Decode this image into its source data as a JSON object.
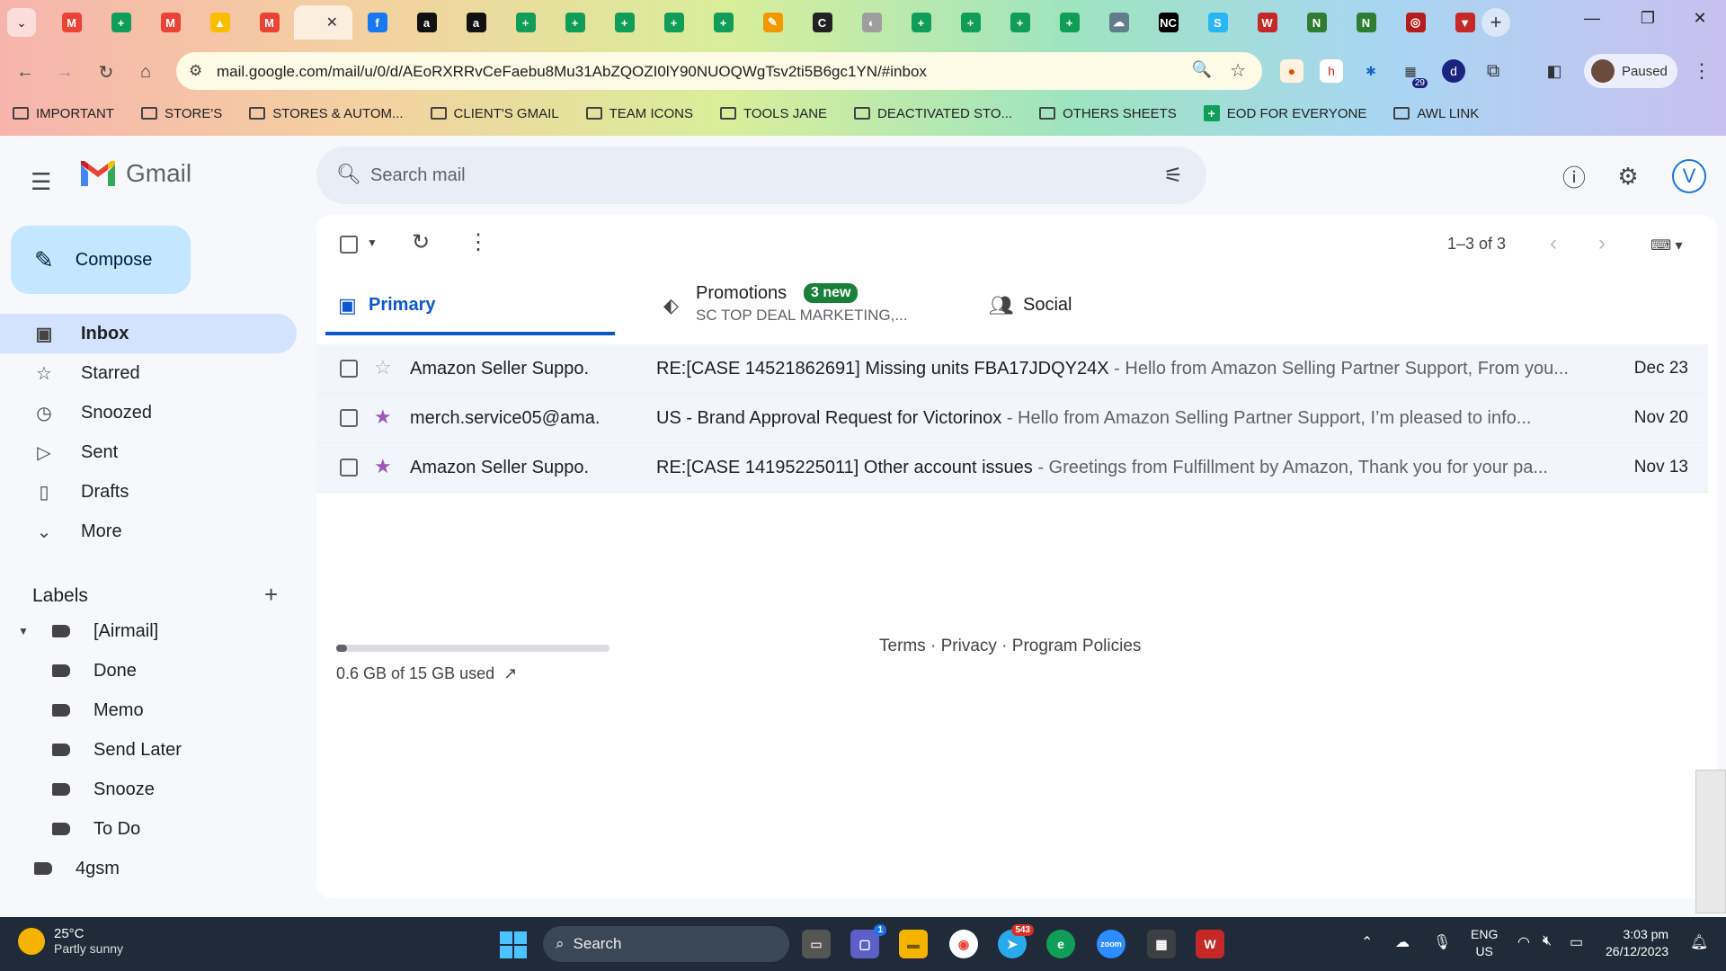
{
  "browser": {
    "active_tab_close": "✕",
    "tabs": [
      {
        "icon": "gmail-icon",
        "glyph": "M",
        "color": "#ea4335"
      },
      {
        "icon": "sheets-icon",
        "glyph": "+",
        "color": "#0f9d58"
      },
      {
        "icon": "gmail-icon",
        "glyph": "M",
        "color": "#ea4335"
      },
      {
        "icon": "drive-icon",
        "glyph": "▲",
        "color": "#fbbc04"
      },
      {
        "icon": "gmail-icon",
        "glyph": "M",
        "color": "#ea4335"
      },
      {
        "icon": "facebook-icon",
        "glyph": "f",
        "color": "#1877f2"
      },
      {
        "icon": "amazon-icon",
        "glyph": "a",
        "color": "#111111"
      },
      {
        "icon": "amazon-icon",
        "glyph": "a",
        "color": "#111111"
      },
      {
        "icon": "sheets-icon",
        "glyph": "+",
        "color": "#0f9d58"
      },
      {
        "icon": "sheets-icon",
        "glyph": "+",
        "color": "#0f9d58"
      },
      {
        "icon": "sheets-icon",
        "glyph": "+",
        "color": "#0f9d58"
      },
      {
        "icon": "sheets-icon",
        "glyph": "+",
        "color": "#0f9d58"
      },
      {
        "icon": "sheets-icon",
        "glyph": "+",
        "color": "#0f9d58"
      },
      {
        "icon": "pencil-app-icon",
        "glyph": "✎",
        "color": "#f29900"
      },
      {
        "icon": "c-app-icon",
        "glyph": "C",
        "color": "#222222"
      },
      {
        "icon": "globe-icon",
        "glyph": "◐",
        "color": "#9e9e9e"
      },
      {
        "icon": "sheets-icon",
        "glyph": "+",
        "color": "#0f9d58"
      },
      {
        "icon": "sheets-icon",
        "glyph": "+",
        "color": "#0f9d58"
      },
      {
        "icon": "sheets-icon",
        "glyph": "+",
        "color": "#0f9d58"
      },
      {
        "icon": "sheets-icon",
        "glyph": "+",
        "color": "#0f9d58"
      },
      {
        "icon": "cloud-app-icon",
        "glyph": "☁",
        "color": "#607d8b"
      },
      {
        "icon": "nc-icon",
        "glyph": "NC",
        "color": "#000000"
      },
      {
        "icon": "sysco-icon",
        "glyph": "S",
        "color": "#29b6f6"
      },
      {
        "icon": "wv-icon",
        "glyph": "W",
        "color": "#c62828"
      },
      {
        "icon": "n-app-icon",
        "glyph": "N",
        "color": "#2e7d32"
      },
      {
        "icon": "n-app-icon",
        "glyph": "N",
        "color": "#2e7d32"
      },
      {
        "icon": "circle-logo-icon",
        "glyph": "◎",
        "color": "#b71c1c"
      },
      {
        "icon": "v-shield-icon",
        "glyph": "▼",
        "color": "#c62828"
      }
    ],
    "url": "mail.google.com/mail/u/0/d/AEoRXRRvCeFaebu8Mu31AbZQOZI0lY90NUOQWgTsv2ti5B6gc1YN/#inbox",
    "ext_badge": "29",
    "profile_status": "Paused",
    "bookmarks": [
      {
        "type": "folder",
        "label": "IMPORTANT"
      },
      {
        "type": "folder",
        "label": "STORE'S"
      },
      {
        "type": "folder",
        "label": "STORES & AUTOM..."
      },
      {
        "type": "folder",
        "label": "CLIENT'S GMAIL"
      },
      {
        "type": "folder",
        "label": "TEAM ICONS"
      },
      {
        "type": "folder",
        "label": "TOOLS JANE"
      },
      {
        "type": "folder",
        "label": "DEACTIVATED STO..."
      },
      {
        "type": "folder",
        "label": "OTHERS SHEETS"
      },
      {
        "type": "sheet",
        "label": "EOD FOR EVERYONE"
      },
      {
        "type": "folder",
        "label": "AWL LINK"
      }
    ]
  },
  "gmail": {
    "app_name": "Gmail",
    "search_placeholder": "Search mail",
    "avatar_letter": "V",
    "compose_label": "Compose",
    "nav": [
      {
        "icon": "inbox-icon",
        "glyph": "▣",
        "label": "Inbox",
        "active": true
      },
      {
        "icon": "star-icon",
        "glyph": "☆",
        "label": "Starred"
      },
      {
        "icon": "clock-icon",
        "glyph": "◷",
        "label": "Snoozed"
      },
      {
        "icon": "send-icon",
        "glyph": "▷",
        "label": "Sent"
      },
      {
        "icon": "draft-icon",
        "glyph": "▯",
        "label": "Drafts"
      },
      {
        "icon": "chevron-down-icon",
        "glyph": "⌄",
        "label": "More"
      }
    ],
    "labels_title": "Labels",
    "labels": [
      {
        "label": "[Airmail]",
        "indent": 0,
        "caret": true
      },
      {
        "label": "Done",
        "indent": 1
      },
      {
        "label": "Memo",
        "indent": 1
      },
      {
        "label": "Send Later",
        "indent": 1
      },
      {
        "label": "Snooze",
        "indent": 1
      },
      {
        "label": "To Do",
        "indent": 1
      },
      {
        "label": "4gsm",
        "indent": 0
      }
    ],
    "range": "1–3 of 3",
    "tabs": {
      "primary": "Primary",
      "promotions": "Promotions",
      "promotions_badge": "3 new",
      "promotions_sub": "SC TOP DEAL MARKETING,...",
      "social": "Social"
    },
    "emails": [
      {
        "sender": "Amazon Seller Suppo.",
        "subject": "RE:[CASE 14521862691] Missing units FBA17JDQY24X",
        "snippet": " - Hello from Amazon Selling Partner Support, From you...",
        "date": "Dec 23",
        "starred": false
      },
      {
        "sender": "merch.service05@ama.",
        "subject": "US - Brand Approval Request for Victorinox",
        "snippet": " - Hello from Amazon Selling Partner Support, I’m pleased to info...",
        "date": "Nov 20",
        "starred": true
      },
      {
        "sender": "Amazon Seller Suppo.",
        "subject": "RE:[CASE 14195225011] Other account issues",
        "snippet": " - Greetings from Fulfillment by Amazon, Thank you for your pa...",
        "date": "Nov 13",
        "starred": true
      }
    ],
    "storage": {
      "text": "0.6 GB of 15 GB used",
      "used_fraction": 0.04
    },
    "footer": "Terms · Privacy · Program Policies"
  },
  "taskbar": {
    "weather_temp": "25°C",
    "weather_desc": "Partly sunny",
    "search_label": "Search",
    "chat_badge": "1",
    "telegram_badge": "543",
    "lang_line1": "ENG",
    "lang_line2": "US",
    "time": "3:03 pm",
    "date": "26/12/2023"
  }
}
